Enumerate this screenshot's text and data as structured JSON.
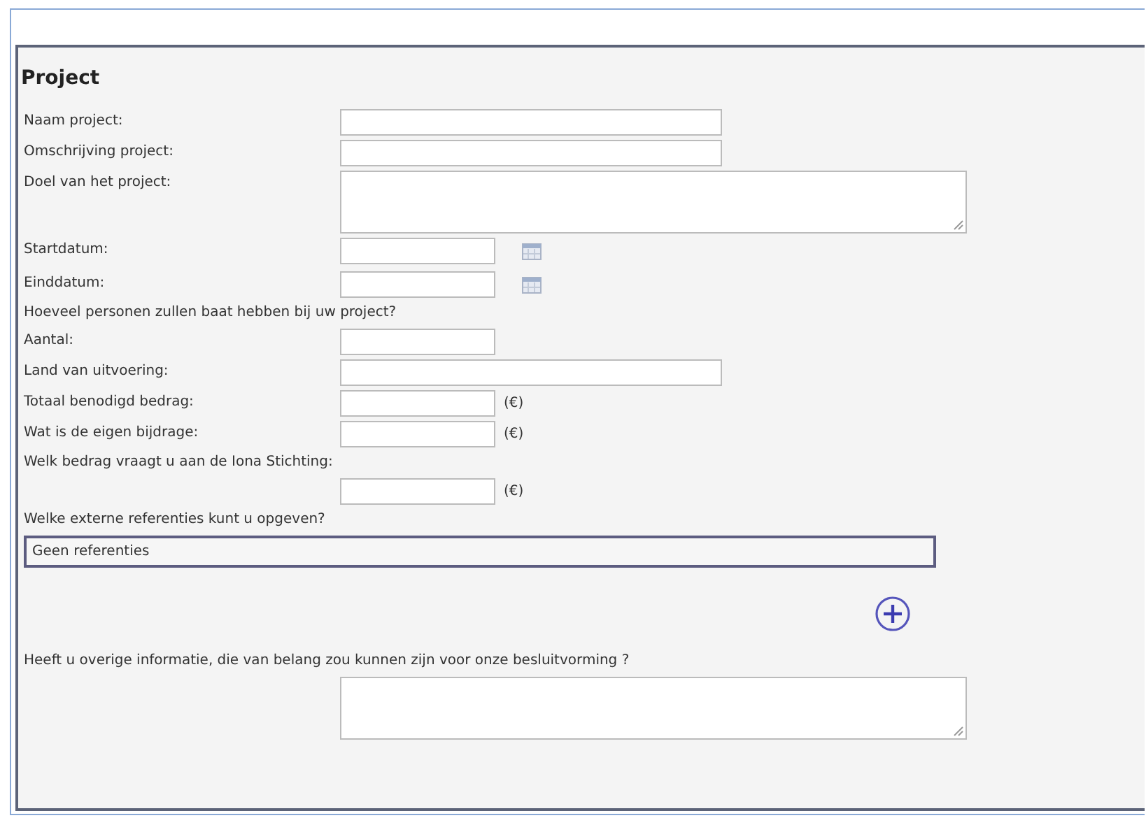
{
  "section": {
    "title": "Project"
  },
  "fields": [
    {
      "kind": "wideinput",
      "label": "Naam project:"
    },
    {
      "kind": "wideinput",
      "label": "Omschrijving project:"
    },
    {
      "kind": "textarea",
      "label": "Doel van het project:"
    },
    {
      "kind": "date",
      "label": "Startdatum:"
    },
    {
      "kind": "date",
      "label": "Einddatum:"
    },
    {
      "kind": "question",
      "label": "Hoeveel personen zullen baat hebben bij uw project?"
    },
    {
      "kind": "input",
      "label": "Aantal:"
    },
    {
      "kind": "wideinput",
      "label": "Land van uitvoering:"
    },
    {
      "kind": "input",
      "label": "Totaal benodigd bedrag:",
      "suffix": "(€)"
    },
    {
      "kind": "input",
      "label": "Wat is de eigen bijdrage:",
      "suffix": "(€)"
    },
    {
      "kind": "question",
      "label": "Welk bedrag vraagt u aan de Iona Stichting:"
    },
    {
      "kind": "input",
      "suffix": "(€)"
    },
    {
      "kind": "question",
      "label": "Welke externe referenties kunt u opgeven?"
    },
    {
      "kind": "list",
      "value": "Geen referenties"
    },
    {
      "kind": "add"
    },
    {
      "kind": "question",
      "label": "Heeft u overige informatie, die van belang zou kunnen zijn voor onze besluitvorming ?"
    },
    {
      "kind": "textarea"
    }
  ]
}
